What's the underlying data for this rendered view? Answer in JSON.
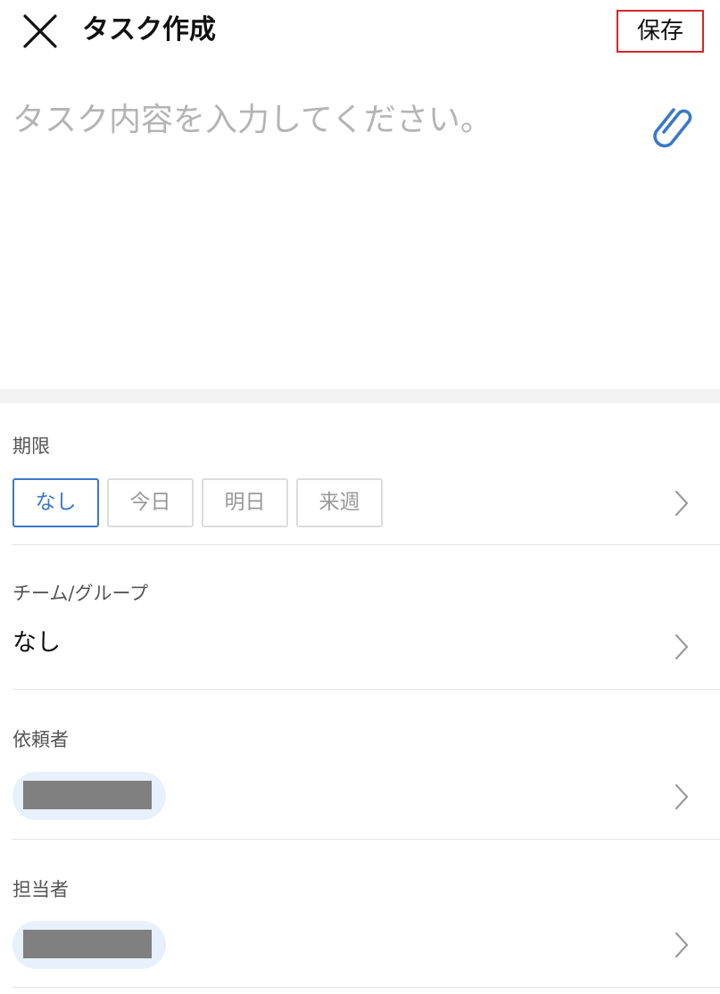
{
  "header": {
    "title": "タスク作成",
    "save_label": "保存"
  },
  "task": {
    "placeholder": "タスク内容を入力してください。",
    "value": ""
  },
  "due": {
    "label": "期限",
    "options": [
      {
        "label": "なし",
        "selected": true
      },
      {
        "label": "今日",
        "selected": false
      },
      {
        "label": "明日",
        "selected": false
      },
      {
        "label": "来週",
        "selected": false
      }
    ]
  },
  "team": {
    "label": "チーム/グループ",
    "value": "なし"
  },
  "requester": {
    "label": "依頼者"
  },
  "assignee": {
    "label": "担当者"
  },
  "colors": {
    "accent": "#3a78c8",
    "save_border": "#d9252b",
    "pill_bg": "#e7f0fb",
    "redaction": "#808080"
  },
  "icons": {
    "close": "close-icon",
    "attach": "paperclip-icon",
    "chevron": "chevron-right-icon"
  }
}
